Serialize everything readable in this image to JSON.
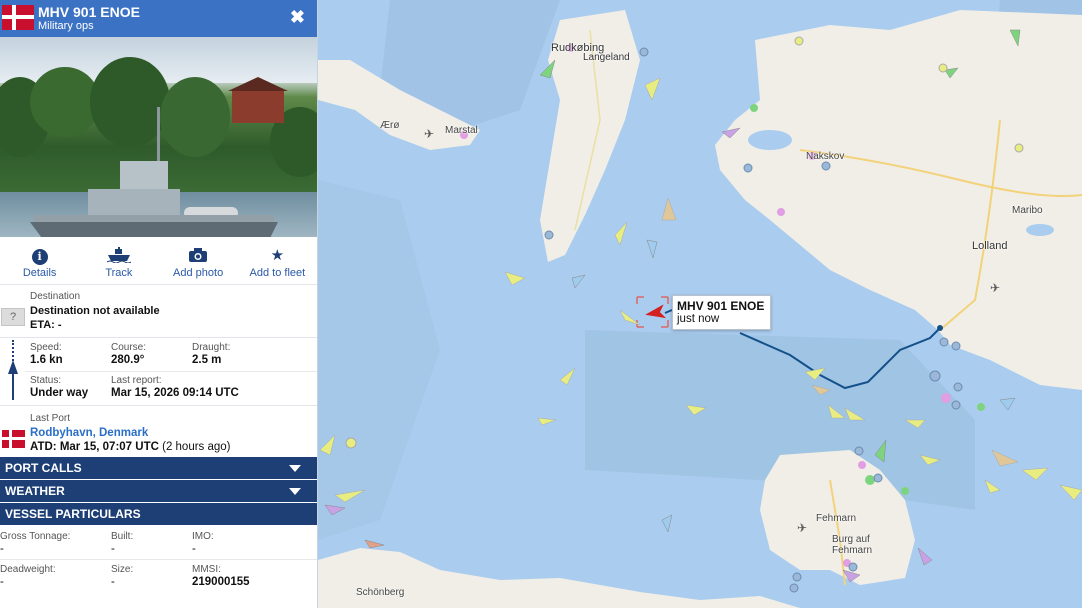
{
  "vessel": {
    "name": "MHV 901 ENOE",
    "type": "Military ops",
    "close_icon": "✖"
  },
  "actions": [
    {
      "label": "Details",
      "icon": "info-icon"
    },
    {
      "label": "Track",
      "icon": "ship-icon"
    },
    {
      "label": "Add photo",
      "icon": "camera-icon"
    },
    {
      "label": "Add to fleet",
      "icon": "star-icon"
    }
  ],
  "destination": {
    "label": "Destination",
    "value": "Destination not available",
    "eta": "ETA: -",
    "unknown_mark": "?"
  },
  "voyage": {
    "speed_label": "Speed:",
    "speed": "1.6 kn",
    "course_label": "Course:",
    "course": "280.9°",
    "draught_label": "Draught:",
    "draught": "2.5 m",
    "status_label": "Status:",
    "status": "Under way",
    "last_report_label": "Last report:",
    "last_report": "Mar 15, 2026 09:14 UTC"
  },
  "last_port": {
    "label": "Last Port",
    "port": "Rodbyhavn, Denmark",
    "atd_label": "ATD:",
    "atd": "Mar 15, 07:07 UTC",
    "ago": "(2 hours ago)"
  },
  "sections": {
    "port_calls": "PORT CALLS",
    "weather": "WEATHER",
    "particulars": "VESSEL PARTICULARS"
  },
  "particulars": {
    "gross_tonnage_label": "Gross Tonnage:",
    "gross_tonnage": "-",
    "built_label": "Built:",
    "built": "-",
    "imo_label": "IMO:",
    "imo": "-",
    "deadweight_label": "Deadweight:",
    "deadweight": "-",
    "size_label": "Size:",
    "size": "-",
    "mmsi_label": "MMSI:",
    "mmsi": "219000155"
  },
  "map": {
    "tooltip_name": "MHV 901 ENOE",
    "tooltip_time": "just now",
    "places": {
      "rudkobing": "Rudkøbing",
      "langeland": "Langeland",
      "aero": "Ærø",
      "marstal": "Marstal",
      "nakskov": "Nakskov",
      "maribo": "Maribo",
      "lolland": "Lolland",
      "fehmarn": "Fehmarn",
      "burg": "Burg auf",
      "burg2": "Fehmarn",
      "schonberg": "Schönberg"
    }
  },
  "colors": {
    "header": "#3c72c4",
    "section": "#1d3f75",
    "link": "#2a6ec6",
    "sea": "#aaccee",
    "land": "#f1eee7",
    "track": "#14508a"
  }
}
